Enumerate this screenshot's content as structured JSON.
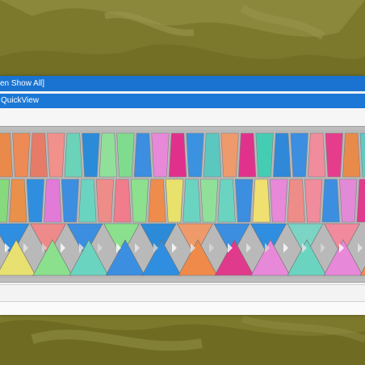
{
  "window": {
    "title": "en Show All]",
    "panel_title": "QuickView"
  },
  "pattern": {
    "row1_colors": [
      "#e98a4a",
      "#ee8a55",
      "#e67c68",
      "#f2908c",
      "#6bd3b8",
      "#2a8bd8",
      "#91e09a",
      "#7fdc8f",
      "#3b8ee0",
      "#e888d8",
      "#e0308c",
      "#3a92e0",
      "#5bc8c0",
      "#ef9a6c",
      "#e0328c",
      "#45cdb4",
      "#2f88d8",
      "#3b8ee0",
      "#f08c9c",
      "#e63c8c",
      "#e88a4a",
      "#63c9c0"
    ],
    "row2_colors": [
      "#86d97c",
      "#e9904a",
      "#2f8ee0",
      "#e27ad8",
      "#3b8ee0",
      "#6bd4c1",
      "#ee8c88",
      "#f07c8c",
      "#8de08e",
      "#ef8c4c",
      "#e8e26c",
      "#6bd4c1",
      "#90e09a",
      "#6bd4c1",
      "#3b8ee0",
      "#f0e070",
      "#e888d8",
      "#ee8c88",
      "#f08c9c",
      "#3b8ee0",
      "#e28ad8",
      "#e03a8c"
    ],
    "row3a_colors": [
      "#2f8ee0",
      "#ee8a8a",
      "#3b8ee0",
      "#8be08e",
      "#2b8bd8",
      "#ef9a6a",
      "#3b8ee0",
      "#2f8ee0",
      "#7bd4c4",
      "#f08a9c"
    ],
    "row3b_colors": [
      "#e8e070",
      "#8be08e",
      "#6bd4c1",
      "#3b8ee0",
      "#2f8ee0",
      "#ef8a4a",
      "#e03a8c",
      "#e888d8",
      "#6bd4c1",
      "#e888d8",
      "#ef8a4a"
    ],
    "accent_blue": "#1a73d0",
    "backdrop_color": "#7d7a2c"
  }
}
